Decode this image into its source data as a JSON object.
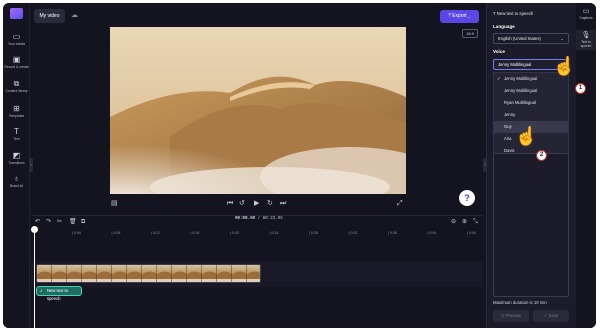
{
  "header": {
    "project_title": "My video",
    "export_label": "Export",
    "aspect_ratio": "16:9"
  },
  "left_rail": {
    "items": [
      {
        "label": "Your media",
        "icon": "folder-icon"
      },
      {
        "label": "Record & create",
        "icon": "camera-icon"
      },
      {
        "label": "Content library",
        "icon": "library-icon"
      },
      {
        "label": "Templates",
        "icon": "templates-icon"
      },
      {
        "label": "Text",
        "icon": "text-icon"
      },
      {
        "label": "Transitions",
        "icon": "transitions-icon"
      },
      {
        "label": "Brand kit",
        "icon": "brand-kit-icon"
      }
    ]
  },
  "timeline": {
    "current_time": "00:00.00",
    "total_time": "00:23.95",
    "ticks": [
      "0:04",
      "0:08",
      "0:12",
      "0:16",
      "0:20",
      "0:24",
      "0:28",
      "0:32",
      "0:36",
      "0:40",
      "0:44",
      "0:48"
    ],
    "audio_clip_label": "New text to speech"
  },
  "panel": {
    "title": "New text to speech",
    "language_label": "Language",
    "language_value": "English (United States)",
    "voice_label": "Voice",
    "voice_value": "Jenny Multilingual",
    "options": [
      "Jenny Multilingual",
      "Jenny Multilingual",
      "Ryan Multilingual",
      "Jenny",
      "Guy",
      "Aria",
      "Davis"
    ],
    "selected_index": 0,
    "hovered_index": 4,
    "max_duration": "Maximum duration is 10 min",
    "preview_label": "Preview",
    "save_label": "Save"
  },
  "right_rail": {
    "items": [
      {
        "label": "Captions",
        "icon": "captions-icon"
      },
      {
        "label": "Text to speech",
        "icon": "microphone-icon"
      }
    ]
  },
  "callouts": [
    "1",
    "2"
  ],
  "colors": {
    "accent": "#5b47e6",
    "background": "#141421",
    "callout_border": "#c0322c"
  }
}
